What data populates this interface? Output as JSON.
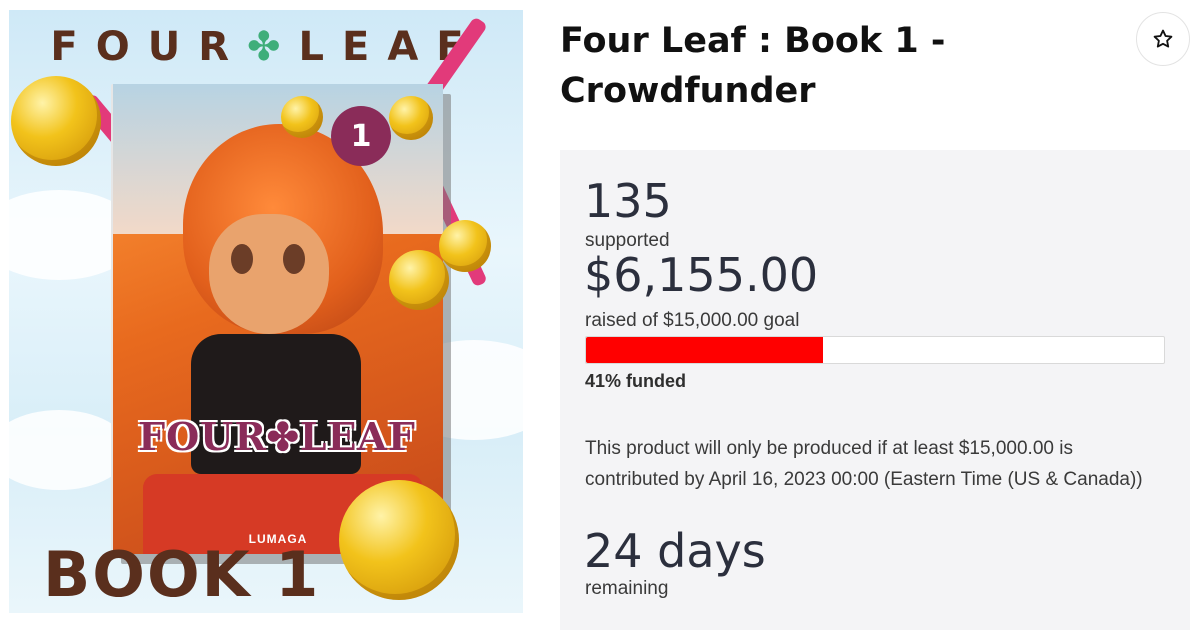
{
  "product": {
    "title": "Four Leaf : Book 1 - Crowdfunder",
    "favorite_icon": "star-icon"
  },
  "cover": {
    "series_left": "FOUR",
    "series_right": "LEAF",
    "volume_number": "1",
    "book_logo": "FOUR✤LEAF",
    "author": "LUMAGA",
    "bottom_text": "BOOK 1"
  },
  "campaign": {
    "supporters_count": "135",
    "supporters_label": "supported",
    "raised_amount": "$6,155.00",
    "raised_label": "raised of $15,000.00 goal",
    "progress_fraction": 0.41,
    "funded_text": "41% funded",
    "notice": "This product will only be produced if at least $15,000.00 is contributed by April 16, 2023 00:00 (Eastern Time (US & Canada))",
    "days_remaining": "24 days",
    "remaining_label": "remaining"
  },
  "colors": {
    "progress": "#ff0000",
    "panel_bg": "#f4f4f6"
  }
}
